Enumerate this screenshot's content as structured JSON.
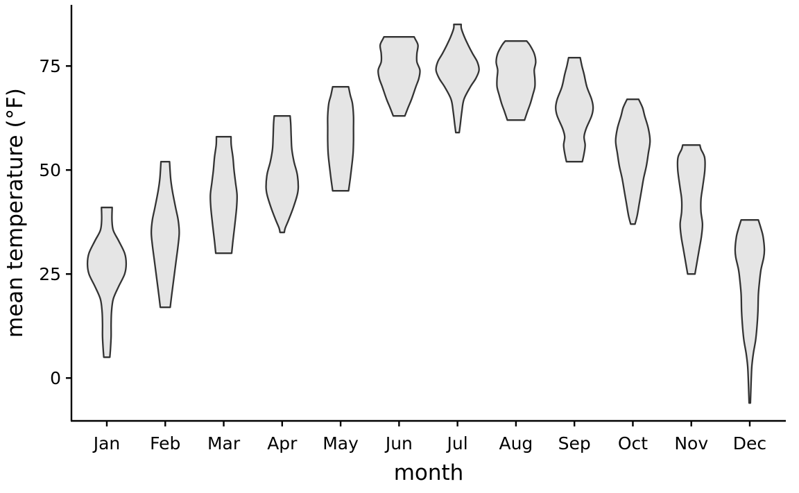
{
  "chart_data": {
    "type": "violin",
    "title": "",
    "xlabel": "month",
    "ylabel": "mean temperature (°F)",
    "ylim": [
      -10.3,
      89.7
    ],
    "yticks": [
      0,
      25,
      50,
      75
    ],
    "ytick_labels": [
      "0",
      "25",
      "50",
      "75"
    ],
    "categories": [
      "Jan",
      "Feb",
      "Mar",
      "Apr",
      "May",
      "Jun",
      "Jul",
      "Aug",
      "Sep",
      "Oct",
      "Nov",
      "Dec"
    ],
    "grid": false,
    "legend": "none",
    "colors": {
      "fill": "#e5e5e5",
      "stroke": "#333333",
      "axis": "#000000"
    },
    "density_note": "profiles are [temperature_F, relative_half_width]; half_width 1.0 = widest violin",
    "series": [
      {
        "name": "Jan",
        "min": 5,
        "max": 41,
        "profile": [
          [
            5,
            0.14
          ],
          [
            7,
            0.17
          ],
          [
            10,
            0.2
          ],
          [
            13,
            0.2
          ],
          [
            16,
            0.22
          ],
          [
            19,
            0.3
          ],
          [
            22,
            0.55
          ],
          [
            25,
            0.83
          ],
          [
            27.5,
            0.9
          ],
          [
            30,
            0.83
          ],
          [
            33,
            0.55
          ],
          [
            35.5,
            0.3
          ],
          [
            38,
            0.24
          ],
          [
            41,
            0.25
          ]
        ]
      },
      {
        "name": "Feb",
        "min": 17,
        "max": 52,
        "profile": [
          [
            17,
            0.23
          ],
          [
            20,
            0.3
          ],
          [
            24,
            0.4
          ],
          [
            28,
            0.5
          ],
          [
            32,
            0.6
          ],
          [
            35,
            0.65
          ],
          [
            38,
            0.6
          ],
          [
            41,
            0.48
          ],
          [
            45,
            0.33
          ],
          [
            48,
            0.25
          ],
          [
            52,
            0.2
          ]
        ]
      },
      {
        "name": "Mar",
        "min": 30,
        "max": 58,
        "profile": [
          [
            30,
            0.37
          ],
          [
            33,
            0.43
          ],
          [
            37,
            0.52
          ],
          [
            41,
            0.6
          ],
          [
            44,
            0.62
          ],
          [
            47,
            0.55
          ],
          [
            50,
            0.48
          ],
          [
            53,
            0.43
          ],
          [
            56,
            0.35
          ],
          [
            58,
            0.34
          ]
        ]
      },
      {
        "name": "Apr",
        "min": 35,
        "max": 63,
        "profile": [
          [
            35,
            0.1
          ],
          [
            36,
            0.14
          ],
          [
            38,
            0.3
          ],
          [
            41,
            0.52
          ],
          [
            44,
            0.7
          ],
          [
            46,
            0.75
          ],
          [
            49,
            0.7
          ],
          [
            52,
            0.55
          ],
          [
            55,
            0.45
          ],
          [
            58,
            0.42
          ],
          [
            61,
            0.4
          ],
          [
            63,
            0.37
          ]
        ]
      },
      {
        "name": "May",
        "min": 45,
        "max": 70,
        "profile": [
          [
            45,
            0.37
          ],
          [
            48,
            0.45
          ],
          [
            51,
            0.52
          ],
          [
            54,
            0.58
          ],
          [
            57,
            0.6
          ],
          [
            60,
            0.6
          ],
          [
            63,
            0.6
          ],
          [
            66,
            0.55
          ],
          [
            68,
            0.45
          ],
          [
            70,
            0.37
          ]
        ]
      },
      {
        "name": "Jun",
        "min": 63,
        "max": 82,
        "profile": [
          [
            63,
            0.27
          ],
          [
            65,
            0.42
          ],
          [
            67,
            0.58
          ],
          [
            70,
            0.78
          ],
          [
            72,
            0.92
          ],
          [
            74,
            0.97
          ],
          [
            76,
            0.83
          ],
          [
            78,
            0.83
          ],
          [
            80,
            0.88
          ],
          [
            81.5,
            0.75
          ],
          [
            82,
            0.7
          ]
        ]
      },
      {
        "name": "Jul",
        "min": 59,
        "max": 85,
        "profile": [
          [
            59,
            0.08
          ],
          [
            61,
            0.13
          ],
          [
            64,
            0.2
          ],
          [
            67,
            0.3
          ],
          [
            70,
            0.6
          ],
          [
            72,
            0.85
          ],
          [
            74,
            1.0
          ],
          [
            76,
            0.92
          ],
          [
            78,
            0.7
          ],
          [
            80,
            0.5
          ],
          [
            82,
            0.32
          ],
          [
            84,
            0.18
          ],
          [
            85,
            0.17
          ]
        ]
      },
      {
        "name": "Aug",
        "min": 62,
        "max": 81,
        "profile": [
          [
            62,
            0.4
          ],
          [
            64,
            0.53
          ],
          [
            66,
            0.67
          ],
          [
            68,
            0.78
          ],
          [
            70,
            0.88
          ],
          [
            72,
            0.88
          ],
          [
            74,
            0.85
          ],
          [
            76,
            0.92
          ],
          [
            78,
            0.85
          ],
          [
            80,
            0.65
          ],
          [
            81,
            0.5
          ]
        ]
      },
      {
        "name": "Sep",
        "min": 52,
        "max": 77,
        "profile": [
          [
            52,
            0.37
          ],
          [
            54,
            0.45
          ],
          [
            56,
            0.5
          ],
          [
            58,
            0.45
          ],
          [
            60,
            0.55
          ],
          [
            63,
            0.8
          ],
          [
            65,
            0.87
          ],
          [
            67,
            0.8
          ],
          [
            70,
            0.58
          ],
          [
            73,
            0.45
          ],
          [
            75,
            0.35
          ],
          [
            77,
            0.27
          ]
        ]
      },
      {
        "name": "Oct",
        "min": 37,
        "max": 67,
        "profile": [
          [
            37,
            0.1
          ],
          [
            39,
            0.2
          ],
          [
            42,
            0.3
          ],
          [
            45,
            0.4
          ],
          [
            48,
            0.5
          ],
          [
            51,
            0.63
          ],
          [
            54,
            0.72
          ],
          [
            57,
            0.8
          ],
          [
            60,
            0.72
          ],
          [
            63,
            0.55
          ],
          [
            65,
            0.45
          ],
          [
            67,
            0.27
          ]
        ]
      },
      {
        "name": "Nov",
        "min": 25,
        "max": 56,
        "profile": [
          [
            25,
            0.17
          ],
          [
            28,
            0.27
          ],
          [
            31,
            0.37
          ],
          [
            34,
            0.47
          ],
          [
            37,
            0.52
          ],
          [
            40,
            0.45
          ],
          [
            43,
            0.45
          ],
          [
            46,
            0.53
          ],
          [
            50,
            0.63
          ],
          [
            53,
            0.62
          ],
          [
            55,
            0.45
          ],
          [
            56,
            0.4
          ]
        ]
      },
      {
        "name": "Dec",
        "min": -6,
        "max": 38,
        "profile": [
          [
            -6,
            0.03
          ],
          [
            -3,
            0.05
          ],
          [
            0,
            0.07
          ],
          [
            3,
            0.1
          ],
          [
            6,
            0.17
          ],
          [
            9,
            0.27
          ],
          [
            12,
            0.33
          ],
          [
            16,
            0.38
          ],
          [
            20,
            0.4
          ],
          [
            23,
            0.45
          ],
          [
            26,
            0.52
          ],
          [
            29,
            0.65
          ],
          [
            31,
            0.68
          ],
          [
            34,
            0.62
          ],
          [
            36,
            0.52
          ],
          [
            38,
            0.4
          ]
        ]
      }
    ]
  }
}
